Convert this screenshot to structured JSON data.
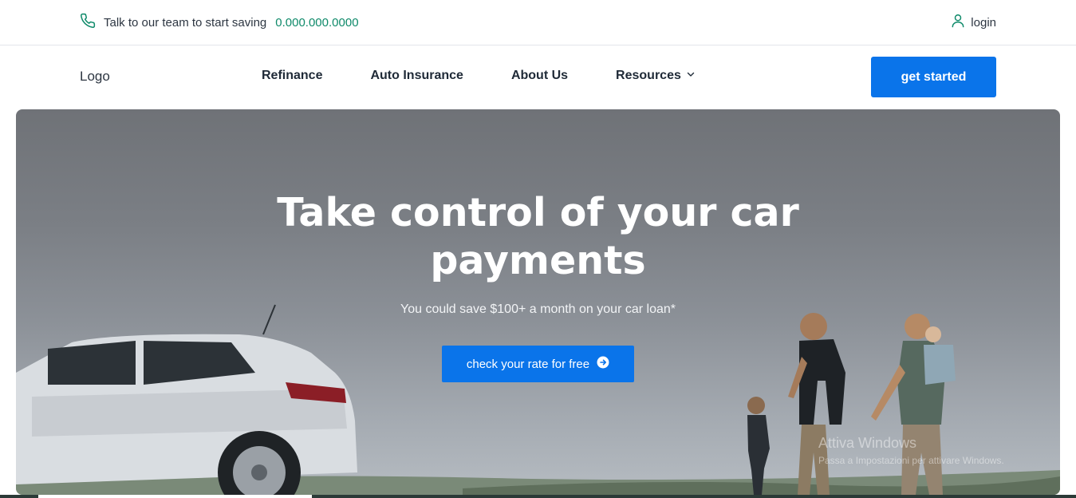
{
  "topbar": {
    "contact_icon": "phone-icon",
    "contact_text": "Talk to our team to start saving",
    "phone": "0.000.000.0000",
    "login_icon": "user-icon",
    "login_label": "login"
  },
  "nav": {
    "logo": "Logo",
    "items": [
      {
        "label": "Refinance"
      },
      {
        "label": "Auto Insurance"
      },
      {
        "label": "About Us"
      },
      {
        "label": "Resources",
        "icon": "chevron-down-icon"
      }
    ],
    "cta_label": "get started"
  },
  "hero": {
    "title": "Take control of your car payments",
    "subtitle": "You could save $100+ a month on your car loan*",
    "button_label": "check your rate for free",
    "button_icon": "arrow-right-circle-icon"
  },
  "watermark": {
    "title": "Attiva Windows",
    "subtitle": "Passa a Impostazioni per attivare Windows."
  },
  "colors": {
    "accent_blue": "#0a74ea",
    "phone_green": "#0f8a6a",
    "text_dark": "#1f2a37"
  }
}
